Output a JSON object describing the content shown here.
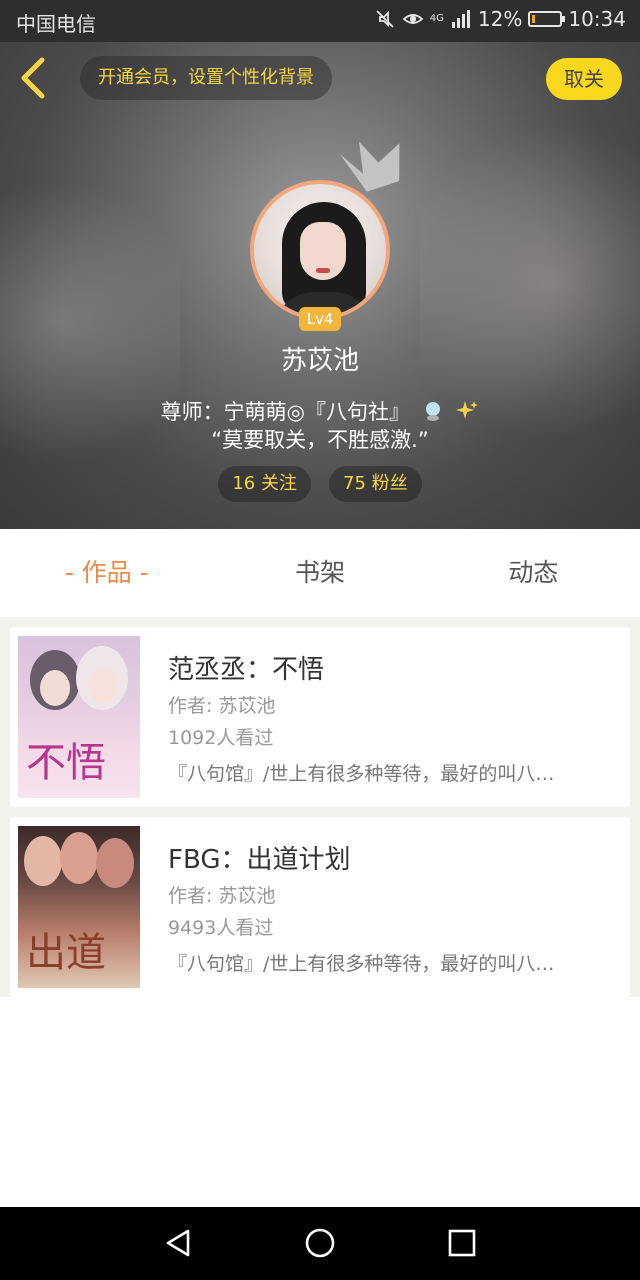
{
  "status_bar": {
    "carrier": "中国电信",
    "network": "4G",
    "battery": "12%",
    "battery_level": 0.12,
    "time": "10:34"
  },
  "header": {
    "vip_banner": "开通会员，设置个性化背景",
    "unfollow_label": "取关",
    "level": "Lv4",
    "username": "苏苡池",
    "bio_line1": "尊师：宁萌萌◎『八句社』",
    "bio_line2": "“莫要取关，不胜感激.”",
    "following": "16 关注",
    "followers": "75 粉丝"
  },
  "tabs": [
    {
      "label": "- 作品 -",
      "active": true
    },
    {
      "label": "书架",
      "active": false
    },
    {
      "label": "动态",
      "active": false
    }
  ],
  "works": [
    {
      "title": "范丞丞：不悟",
      "author": "作者: 苏苡池",
      "views": "1092人看过",
      "description": "『八句馆』/世上有很多种等待，最好的叫八…",
      "cover_text": "不悟"
    },
    {
      "title": "FBG：出道计划",
      "author": "作者: 苏苡池",
      "views": "9493人看过",
      "description": "『八句馆』/世上有很多种等待，最好的叫八…",
      "cover_text": "出道"
    }
  ],
  "colors": {
    "accent": "#ef8a4a",
    "vip_yellow": "#f7d542",
    "unfollow_bg": "#f9d71c",
    "level_bg": "#f2b73a"
  },
  "icons": [
    "back-chevron-icon",
    "crown-icon",
    "mute-icon",
    "eye-icon",
    "signal-icon",
    "battery-icon",
    "nav-back-icon",
    "nav-home-icon",
    "nav-recent-icon"
  ]
}
